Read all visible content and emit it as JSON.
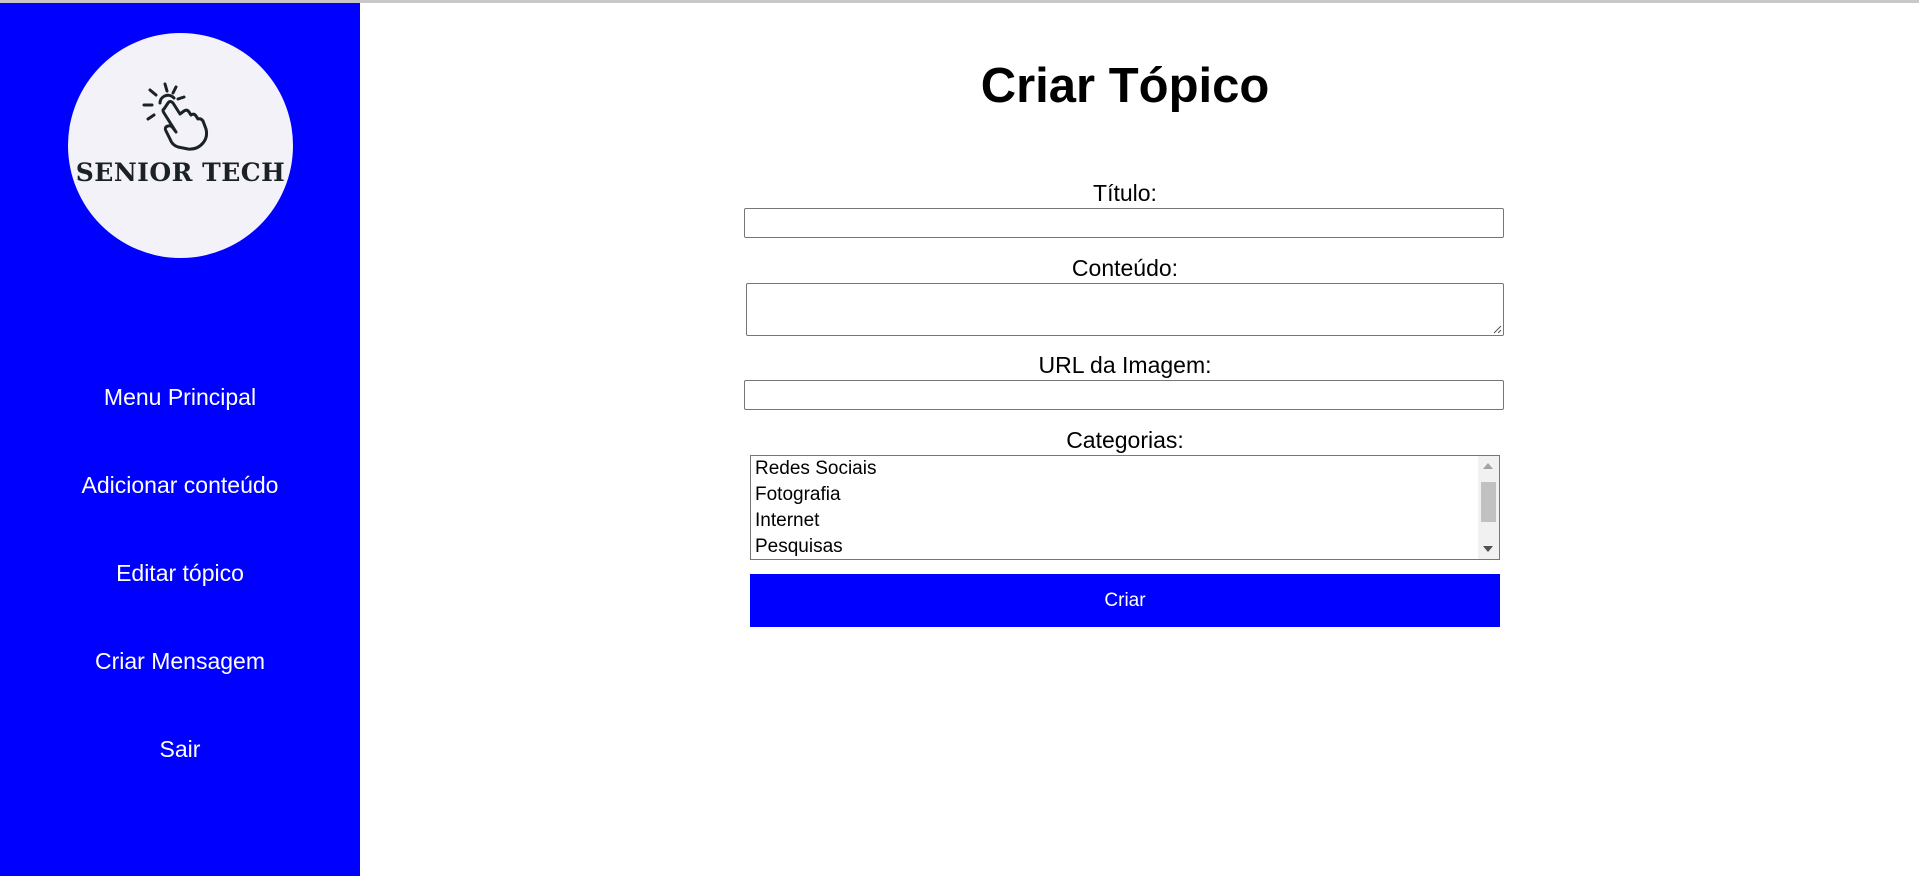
{
  "sidebar": {
    "logo_text": "SENIOR TECH",
    "logo_icon": "tap-hand-icon",
    "background_color": "#0000ff",
    "items": [
      {
        "label": "Menu Principal"
      },
      {
        "label": "Adicionar conteúdo"
      },
      {
        "label": "Editar tópico"
      },
      {
        "label": "Criar Mensagem"
      },
      {
        "label": "Sair"
      }
    ]
  },
  "main": {
    "title": "Criar Tópico",
    "form": {
      "titulo_label": "Título:",
      "titulo_value": "",
      "conteudo_label": "Conteúdo:",
      "conteudo_value": "",
      "url_label": "URL da Imagem:",
      "url_value": "",
      "categorias_label": "Categorias:",
      "categorias_options": [
        "Redes Sociais",
        "Fotografia",
        "Internet",
        "Pesquisas"
      ],
      "submit_label": "Criar"
    }
  },
  "colors": {
    "accent": "#0000ff",
    "logo_background": "#f3f2f8"
  }
}
